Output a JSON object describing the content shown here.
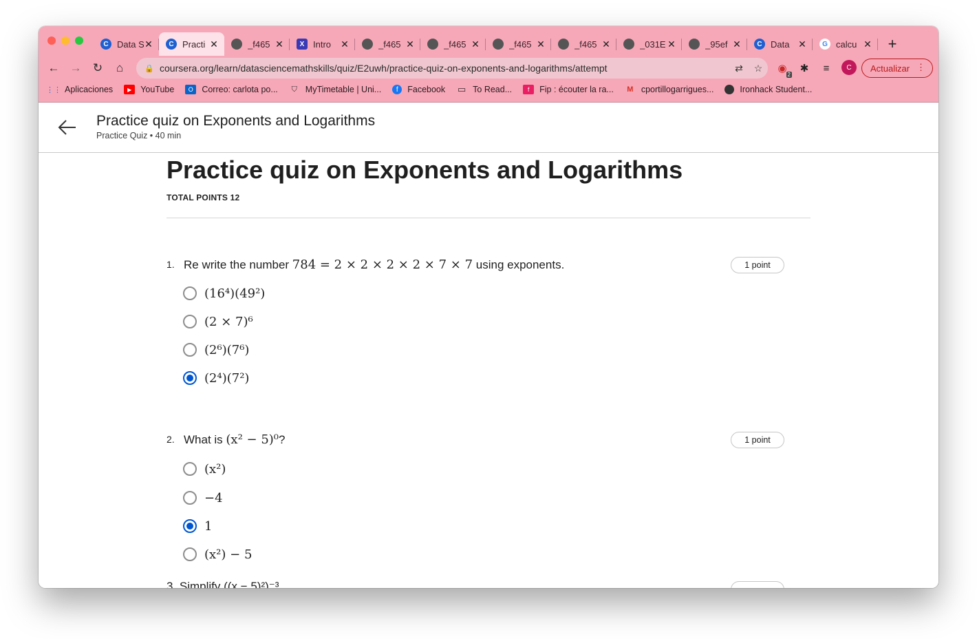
{
  "browser": {
    "tabs": [
      {
        "title": "Data S",
        "icon": "coursera-icon",
        "active": false
      },
      {
        "title": "Practi",
        "icon": "coursera-icon",
        "active": true
      },
      {
        "title": "_f465",
        "icon": "globe-icon",
        "active": false
      },
      {
        "title": "Intro",
        "icon": "x-app-icon",
        "active": false
      },
      {
        "title": "_f465",
        "icon": "globe-icon",
        "active": false
      },
      {
        "title": "_f465",
        "icon": "globe-icon",
        "active": false
      },
      {
        "title": "_f465",
        "icon": "globe-icon",
        "active": false
      },
      {
        "title": "_f465",
        "icon": "globe-icon",
        "active": false
      },
      {
        "title": "_031E",
        "icon": "globe-icon",
        "active": false
      },
      {
        "title": "_95ef",
        "icon": "globe-icon",
        "active": false
      },
      {
        "title": "Data",
        "icon": "coursera-icon",
        "active": false
      },
      {
        "title": "calcu",
        "icon": "google-icon",
        "active": false
      }
    ],
    "url": "coursera.org/learn/datasciencemathskills/quiz/E2uwh/practice-quiz-on-exponents-and-logarithms/attempt",
    "update_label": "Actualizar",
    "profile_initial": "C",
    "extension_badge": "2",
    "bookmarks": [
      {
        "label": "Aplicaciones",
        "icon": "apps-grid-icon"
      },
      {
        "label": "YouTube",
        "icon": "youtube-icon"
      },
      {
        "label": "Correo: carlota po...",
        "icon": "outlook-icon"
      },
      {
        "label": "MyTimetable | Uni...",
        "icon": "shield-icon"
      },
      {
        "label": "Facebook",
        "icon": "facebook-icon"
      },
      {
        "label": "To Read...",
        "icon": "folder-icon"
      },
      {
        "label": "Fip : écouter la ra...",
        "icon": "fip-icon"
      },
      {
        "label": "cportillogarrigues...",
        "icon": "gmail-icon"
      },
      {
        "label": "Ironhack Student...",
        "icon": "globe-icon"
      }
    ]
  },
  "header": {
    "title": "Practice quiz on Exponents and Logarithms",
    "subtitle": "Practice Quiz • 40 min"
  },
  "quiz": {
    "title": "Practice quiz on Exponents and Logarithms",
    "total_points": "TOTAL POINTS 12",
    "questions": [
      {
        "number": "1.",
        "text_before": "Re write the number ",
        "math": "784 = 2 × 2 × 2 × 2 × 7 × 7",
        "text_after": " using exponents.",
        "points": "1 point",
        "options": [
          {
            "label": "(16⁴)(49²)",
            "selected": false
          },
          {
            "label": "(2 × 7)⁶",
            "selected": false
          },
          {
            "label": "(2⁶)(7⁶)",
            "selected": false
          },
          {
            "label": "(2⁴)(7²)",
            "selected": true
          }
        ]
      },
      {
        "number": "2.",
        "text_before": "What is ",
        "math": "(x² − 5)⁰",
        "text_after": "?",
        "points": "1 point",
        "options": [
          {
            "label": "(x²)",
            "selected": false
          },
          {
            "label": "−4",
            "selected": false
          },
          {
            "label": "1",
            "selected": true
          },
          {
            "label": "(x²) − 5",
            "selected": false
          }
        ]
      }
    ],
    "partial_question": "3. Simplify ((x − 5)²)⁻³"
  }
}
